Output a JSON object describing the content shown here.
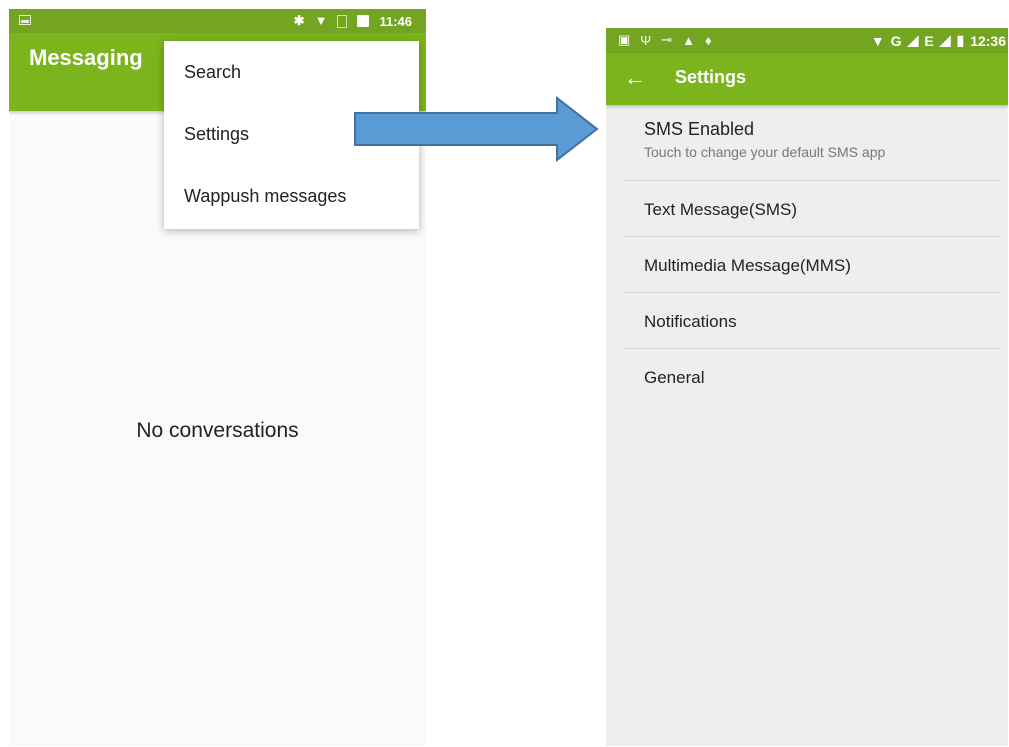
{
  "left_screen": {
    "statusbar": {
      "time": "11:46"
    },
    "appbar": {
      "title": "Messaging"
    },
    "overflow_menu": {
      "items": [
        {
          "label": "Search"
        },
        {
          "label": "Settings"
        },
        {
          "label": "Wappush messages"
        }
      ]
    },
    "empty_state": "No conversations"
  },
  "right_screen": {
    "statusbar": {
      "network_label": "G",
      "network_label_2": "E",
      "time": "12:36"
    },
    "appbar": {
      "title": "Settings"
    },
    "settings": [
      {
        "title": "SMS Enabled",
        "subtitle": "Touch to change your default SMS app"
      },
      {
        "title": "Text Message(SMS)"
      },
      {
        "title": "Multimedia Message(MMS)"
      },
      {
        "title": "Notifications"
      },
      {
        "title": "General"
      }
    ]
  },
  "colors": {
    "statusbar_green": "#73a522",
    "appbar_green": "#7cb41e",
    "arrow_fill": "#5b9bd5",
    "arrow_stroke": "#41719c"
  },
  "icons": {
    "back": "arrow-left-icon",
    "arrow": "transition-arrow"
  }
}
